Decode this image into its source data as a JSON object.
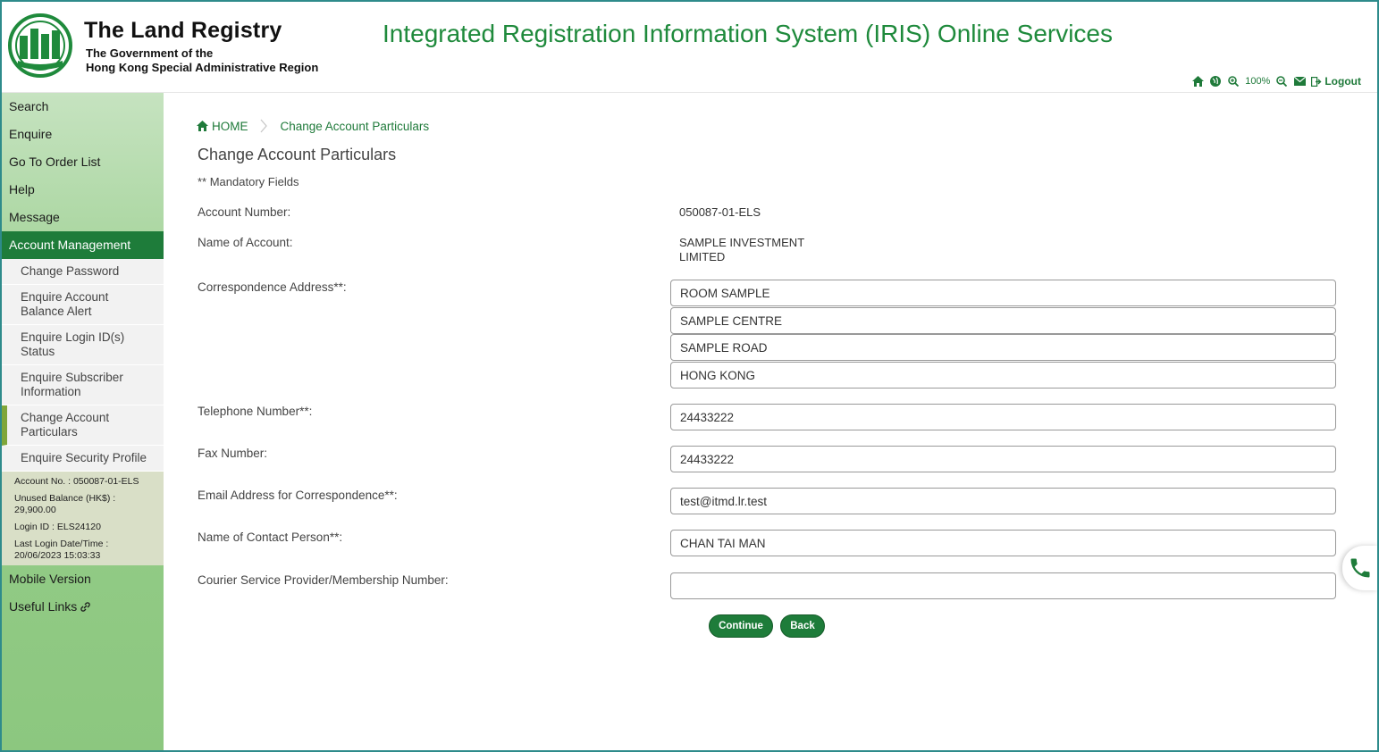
{
  "header": {
    "org_title": "The Land Registry",
    "org_sub1": "The Government of the",
    "org_sub2": "Hong Kong Special Administrative Region",
    "system_title": "Integrated Registration Information System (IRIS) Online Services",
    "zoom": "100%",
    "logout": "Logout"
  },
  "sidebar": {
    "items": [
      {
        "label": "Search"
      },
      {
        "label": "Enquire"
      },
      {
        "label": "Go To Order List"
      },
      {
        "label": "Help"
      },
      {
        "label": "Message"
      },
      {
        "label": "Account Management"
      }
    ],
    "subitems": [
      {
        "label_1": "Change Password",
        "label_2": ""
      },
      {
        "label_1": "Enquire Account",
        "label_2": "Balance Alert"
      },
      {
        "label_1": "Enquire Login ID(s)",
        "label_2": "Status"
      },
      {
        "label_1": "Enquire Subscriber",
        "label_2": "Information"
      },
      {
        "label_1": "Change Account",
        "label_2": "Particulars"
      },
      {
        "label_1": "Enquire Security Profile",
        "label_2": ""
      }
    ],
    "account_info": {
      "account_no": "Account No. : 050087-01-ELS",
      "unused_balance_label": "Unused Balance (HK$) :",
      "unused_balance": "29,900.00",
      "login_id": "Login ID : ELS24120",
      "last_login_label": "Last Login Date/Time :",
      "last_login": "20/06/2023 15:03:33"
    },
    "bottom_items": [
      {
        "label": "Mobile Version"
      },
      {
        "label": "Useful Links"
      }
    ]
  },
  "breadcrumb": {
    "home": "HOME",
    "current": "Change Account Particulars"
  },
  "page": {
    "title": "Change Account Particulars",
    "mandatory_note": "** Mandatory Fields"
  },
  "form": {
    "account_number_label": "Account Number:",
    "account_number": "050087-01-ELS",
    "account_name_label": "Name of Account:",
    "account_name_1": "SAMPLE INVESTMENT",
    "account_name_2": "LIMITED",
    "address_label": "Correspondence Address**:",
    "address_1": "ROOM SAMPLE",
    "address_2": "SAMPLE CENTRE",
    "address_3": "SAMPLE ROAD",
    "address_4": "HONG KONG",
    "telephone_label": "Telephone Number**:",
    "telephone": "24433222",
    "fax_label": "Fax Number:",
    "fax": "24433222",
    "email_label": "Email Address for Correspondence**:",
    "email": "test@itmd.lr.test",
    "contact_label": "Name of Contact Person**:",
    "contact": "CHAN TAI MAN",
    "courier_label": "Courier Service Provider/Membership Number:",
    "courier": ""
  },
  "buttons": {
    "continue": "Continue",
    "back": "Back"
  },
  "colors": {
    "brand_green": "#1e7c3a",
    "title_green": "#1f8a3c",
    "sidebar_green": "#8cc77f"
  }
}
